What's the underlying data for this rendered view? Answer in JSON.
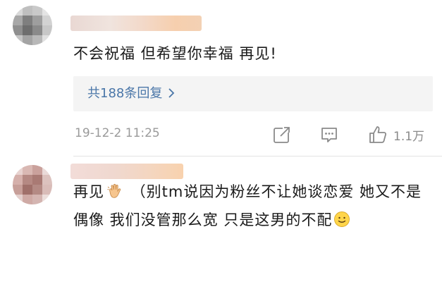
{
  "comments": [
    {
      "text": "不会祝福 但希望你幸福 再见!",
      "replies_label": "共188条回复",
      "timestamp": "19-12-2 11:25",
      "like_count": "1.1万"
    },
    {
      "text_prefix": "再见",
      "text_emoji": "waving-hand",
      "text_middle": " （别tm说因为粉丝不让她谈恋爱 她又不是偶像 我们没管那么宽 只是这男的不配",
      "text_end_emoji": "slightly-smiling-face"
    }
  ],
  "icons": {
    "share": "share-icon",
    "comment": "comment-icon",
    "like": "thumbs-up-icon",
    "reply_chevron": "chevron-right-icon"
  },
  "colors": {
    "text": "#1a1a1a",
    "link": "#4a76a8",
    "muted": "#9a9a9a",
    "reply_bg": "#f4f4f4"
  }
}
